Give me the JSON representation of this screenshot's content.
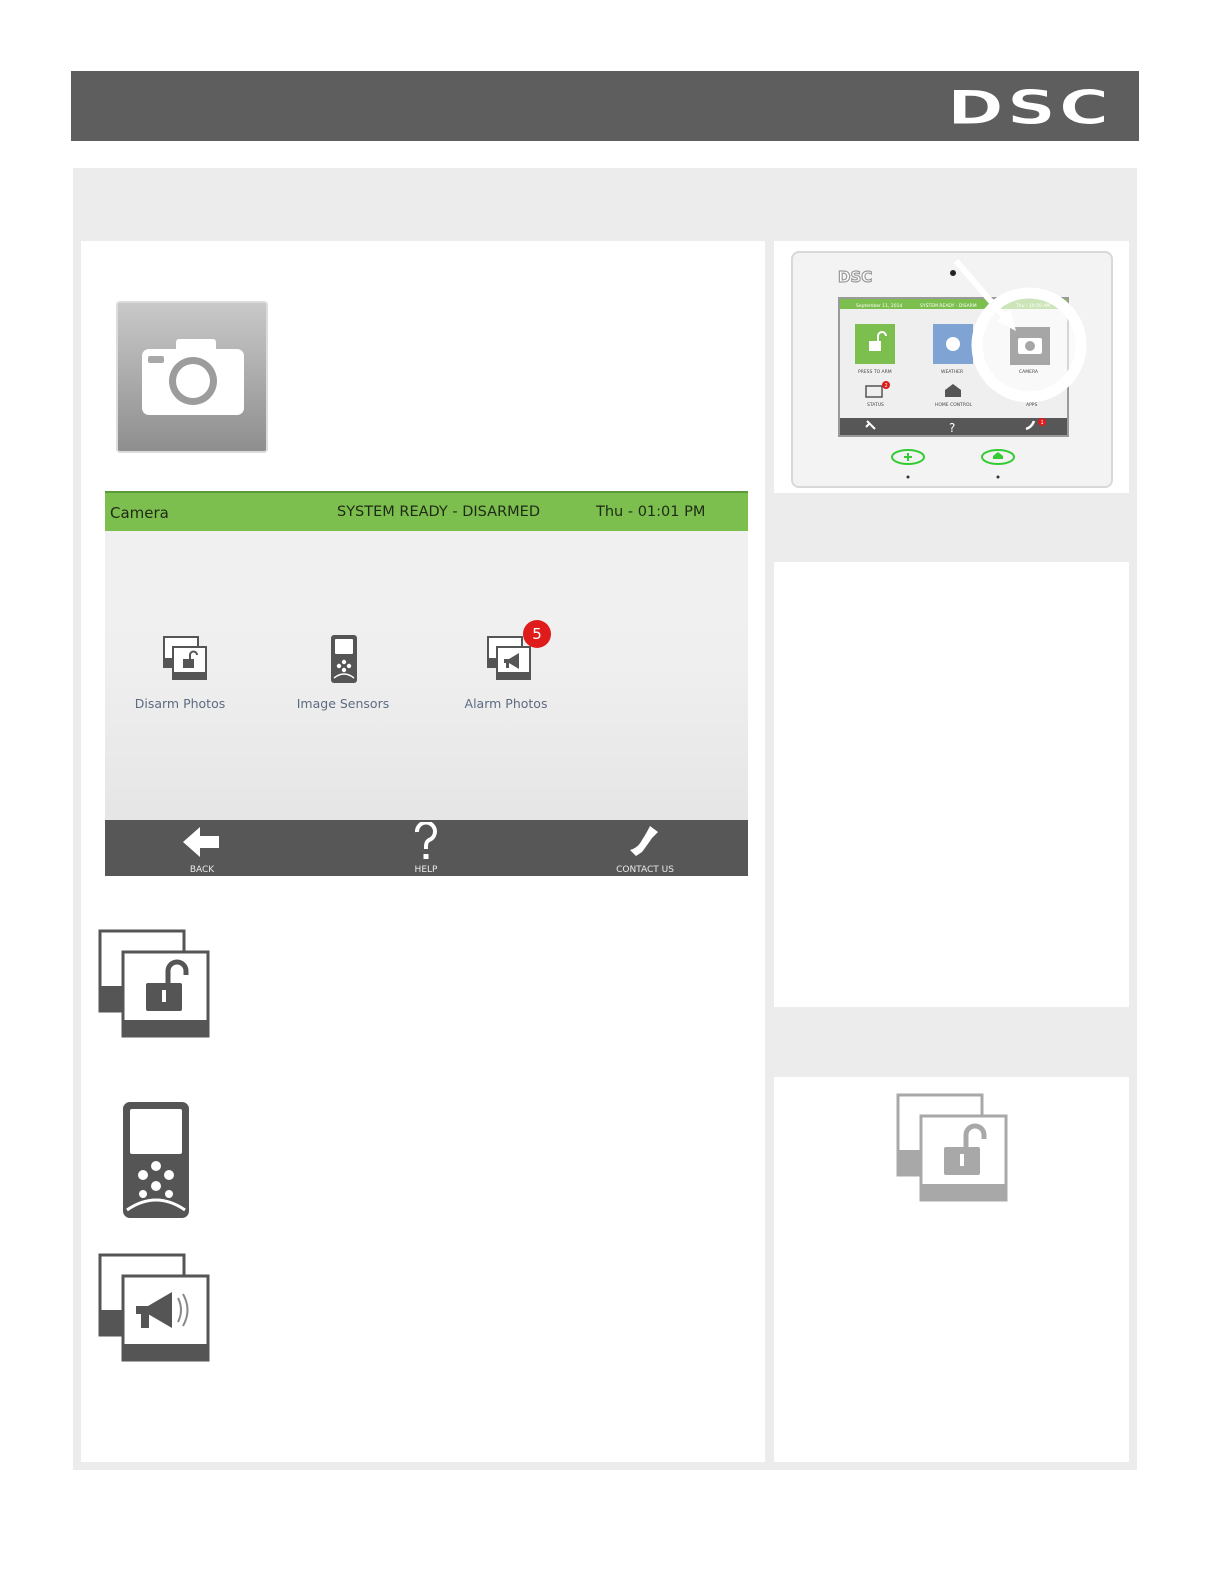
{
  "brand": {
    "logo_text": "DSC"
  },
  "camera_screen": {
    "title": "Camera",
    "status": "SYSTEM READY - DISARMED",
    "datetime": "Thu - 01:01 PM",
    "tiles": [
      {
        "label": "Disarm Photos",
        "icon": "disarm-photos-icon"
      },
      {
        "label": "Image Sensors",
        "icon": "image-sensor-icon"
      },
      {
        "label": "Alarm Photos",
        "icon": "alarm-photos-icon",
        "badge": "5"
      }
    ],
    "nav": {
      "back": "BACK",
      "help": "HELP",
      "contact": "CONTACT US"
    }
  },
  "panel_thumbnail": {
    "logo_text": "DSC",
    "date": "September 11, 2014",
    "status": "SYSTEM READY - DISARM",
    "time": "Thu - 10:59 AM",
    "tiles": [
      "PRESS TO ARM",
      "WEATHER",
      "CAMERA",
      "STATUS",
      "HOME CONTROL",
      "APPS"
    ],
    "status_badge": "2",
    "contact_badge": "1"
  },
  "colors": {
    "header": "#5e5e5e",
    "status_bar": "#7dbf4f",
    "nav_bar": "#575757",
    "badge": "#e01b1b",
    "tile_text": "#5d6b82"
  }
}
